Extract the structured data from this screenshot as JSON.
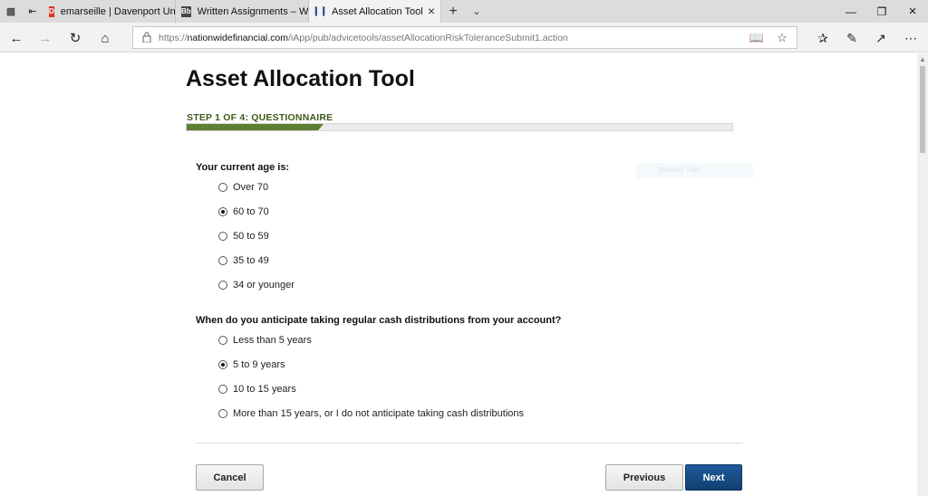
{
  "browser": {
    "tabs": [
      {
        "label": "emarseille | Davenport Univ",
        "favicon_color": "#d9342b",
        "active": false
      },
      {
        "label": "Written Assignments – Win",
        "favicon_color": "#444444",
        "active": false
      },
      {
        "label": "Asset Allocation Tool",
        "favicon_color": "#1c4f8a",
        "active": true
      }
    ],
    "url": {
      "scheme": "https://",
      "host": "nationwidefinancial.com",
      "path": "/iApp/pub/advicetools/assetAllocationRiskToleranceSubmit1.action"
    }
  },
  "page": {
    "title": "Asset Allocation Tool",
    "step_label": "STEP 1 OF 4: QUESTIONNAIRE",
    "progress_fraction": 0.25,
    "accent_color": "#5d7f32",
    "ghost_text": "Window Tray"
  },
  "questions": [
    {
      "text": "Your current age is:",
      "options": [
        {
          "label": "Over 70",
          "checked": false
        },
        {
          "label": "60 to 70",
          "checked": true
        },
        {
          "label": "50 to 59",
          "checked": false
        },
        {
          "label": "35 to 49",
          "checked": false
        },
        {
          "label": "34 or younger",
          "checked": false
        }
      ]
    },
    {
      "text": "When do you anticipate taking regular cash distributions from your account?",
      "options": [
        {
          "label": "Less than 5 years",
          "checked": false
        },
        {
          "label": "5 to 9 years",
          "checked": true
        },
        {
          "label": "10 to 15 years",
          "checked": false
        },
        {
          "label": "More than 15 years, or I do not anticipate taking cash distributions",
          "checked": false
        }
      ]
    }
  ],
  "buttons": {
    "cancel": "Cancel",
    "previous": "Previous",
    "next": "Next"
  }
}
